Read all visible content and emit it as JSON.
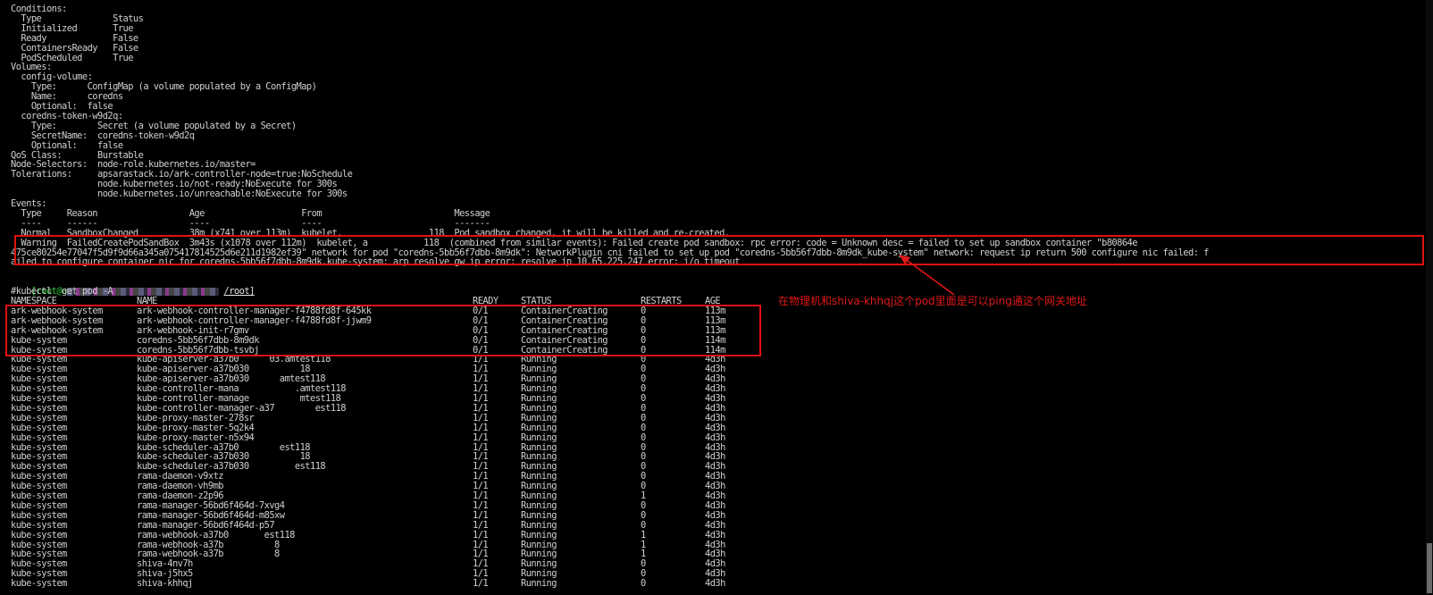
{
  "terminal": {
    "describe_lines": [
      "Conditions:",
      "  Type              Status",
      "  Initialized       True",
      "  Ready             False",
      "  ContainersReady   False",
      "  PodScheduled      True",
      "Volumes:",
      "  config-volume:",
      "    Type:      ConfigMap (a volume populated by a ConfigMap)",
      "    Name:      coredns",
      "    Optional:  false",
      "  coredns-token-w9d2q:",
      "    Type:        Secret (a volume populated by a Secret)",
      "    SecretName:  coredns-token-w9d2q",
      "    Optional:    false",
      "QoS Class:       Burstable",
      "Node-Selectors:  node-role.kubernetes.io/master=",
      "Tolerations:     apsarastack.io/ark-controller-node=true:NoSchedule",
      "                 node.kubernetes.io/not-ready:NoExecute for 300s",
      "                 node.kubernetes.io/unreachable:NoExecute for 300s",
      "Events:",
      "  Type     Reason                  Age                   From                          Message",
      "  ----     ------                  ----                  ----                          -------",
      "  Normal   SandboxChanged          38m (x741 over 113m)  kubelet,                 118  Pod sandbox changed, it will be killed and re-created.",
      "  Warning  FailedCreatePodSandBox  3m43s (x1078 over 112m)  kubelet, a           118  (combined from similar events): Failed create pod sandbox: rpc error: code = Unknown desc = failed to set up sandbox container \"b80864e",
      "475ce80254e77047f5d9f9d66a345a075417814525d6e211d1982ef39\" network for pod \"coredns-5bb56f7dbb-8m9dk\": NetworkPlugin cni failed to set up pod \"coredns-5bb56f7dbb-8m9dk_kube-system\" network: request ip return 500 configure nic failed: f",
      "ailed to configure container nic for coredns-5bb56f7dbb-8m9dk.kube-system: arp resolve gw ip error: resolve ip 10.65.225.247 error: i/o timeout"
    ],
    "prompt": {
      "user_host": "[root@a",
      "path": "/root]",
      "command": "#kubectl  get pod -A"
    },
    "table_header": [
      "NAMESPACE",
      "NAME",
      "READY",
      "STATUS",
      "RESTARTS",
      "AGE"
    ],
    "rows": [
      [
        "ark-webhook-system",
        "ark-webhook-controller-manager-f4788fd8f-645kk",
        "0/1",
        "ContainerCreating",
        "0",
        "113m"
      ],
      [
        "ark-webhook-system",
        "ark-webhook-controller-manager-f4788fd8f-jjwm9",
        "0/1",
        "ContainerCreating",
        "0",
        "113m"
      ],
      [
        "ark-webhook-system",
        "ark-webhook-init-r7gmv",
        "0/1",
        "ContainerCreating",
        "0",
        "113m"
      ],
      [
        "kube-system",
        "coredns-5bb56f7dbb-8m9dk",
        "0/1",
        "ContainerCreating",
        "0",
        "114m"
      ],
      [
        "kube-system",
        "coredns-5bb56f7dbb-tsvbj",
        "0/1",
        "ContainerCreating",
        "0",
        "114m"
      ],
      [
        "kube-system",
        "kube-apiserver-a37b0      03.amtest118",
        "1/1",
        "Running",
        "0",
        "4d3h"
      ],
      [
        "kube-system",
        "kube-apiserver-a37b030          18",
        "1/1",
        "Running",
        "0",
        "4d3h"
      ],
      [
        "kube-system",
        "kube-apiserver-a37b030      amtest118",
        "1/1",
        "Running",
        "0",
        "4d3h"
      ],
      [
        "kube-system",
        "kube-controller-mana           .amtest118",
        "1/1",
        "Running",
        "0",
        "4d3h"
      ],
      [
        "kube-system",
        "kube-controller-manage          mtest118",
        "1/1",
        "Running",
        "0",
        "4d3h"
      ],
      [
        "kube-system",
        "kube-controller-manager-a37        est118",
        "1/1",
        "Running",
        "0",
        "4d3h"
      ],
      [
        "kube-system",
        "kube-proxy-master-278sr",
        "1/1",
        "Running",
        "0",
        "4d3h"
      ],
      [
        "kube-system",
        "kube-proxy-master-5q2k4",
        "1/1",
        "Running",
        "0",
        "4d3h"
      ],
      [
        "kube-system",
        "kube-proxy-master-n5x94",
        "1/1",
        "Running",
        "0",
        "4d3h"
      ],
      [
        "kube-system",
        "kube-scheduler-a37b0        est118",
        "1/1",
        "Running",
        "0",
        "4d3h"
      ],
      [
        "kube-system",
        "kube-scheduler-a37b030          18",
        "1/1",
        "Running",
        "0",
        "4d3h"
      ],
      [
        "kube-system",
        "kube-scheduler-a37b030         est118",
        "1/1",
        "Running",
        "0",
        "4d3h"
      ],
      [
        "kube-system",
        "rama-daemon-v9xtz",
        "1/1",
        "Running",
        "0",
        "4d3h"
      ],
      [
        "kube-system",
        "rama-daemon-vh9mb",
        "1/1",
        "Running",
        "0",
        "4d3h"
      ],
      [
        "kube-system",
        "rama-daemon-z2p96",
        "1/1",
        "Running",
        "1",
        "4d3h"
      ],
      [
        "kube-system",
        "rama-manager-56bd6f464d-7xvg4",
        "1/1",
        "Running",
        "0",
        "4d3h"
      ],
      [
        "kube-system",
        "rama-manager-56bd6f464d-m85xw",
        "1/1",
        "Running",
        "0",
        "4d3h"
      ],
      [
        "kube-system",
        "rama-manager-56bd6f464d-p57",
        "1/1",
        "Running",
        "0",
        "4d3h"
      ],
      [
        "kube-system",
        "rama-webhook-a37b0       est118",
        "1/1",
        "Running",
        "1",
        "4d3h"
      ],
      [
        "kube-system",
        "rama-webhook-a37b          8",
        "1/1",
        "Running",
        "1",
        "4d3h"
      ],
      [
        "kube-system",
        "rama-webhook-a37b          8",
        "1/1",
        "Running",
        "1",
        "4d3h"
      ],
      [
        "kube-system",
        "shiva-4nv7h",
        "1/1",
        "Running",
        "0",
        "4d3h"
      ],
      [
        "kube-system",
        "shiva-j5hx5",
        "1/1",
        "Running",
        "0",
        "4d3h"
      ],
      [
        "kube-system",
        "shiva-khhqj",
        "1/1",
        "Running",
        "0",
        "4d3h"
      ]
    ]
  },
  "annotation": {
    "text": "在物理机和shiva-khhqj这个pod里面是可以ping通这个网关地址"
  },
  "colors": {
    "background": "#000000",
    "text": "#d0d0d0",
    "annotation": "#e01818",
    "prompt": "#2ecc40"
  }
}
